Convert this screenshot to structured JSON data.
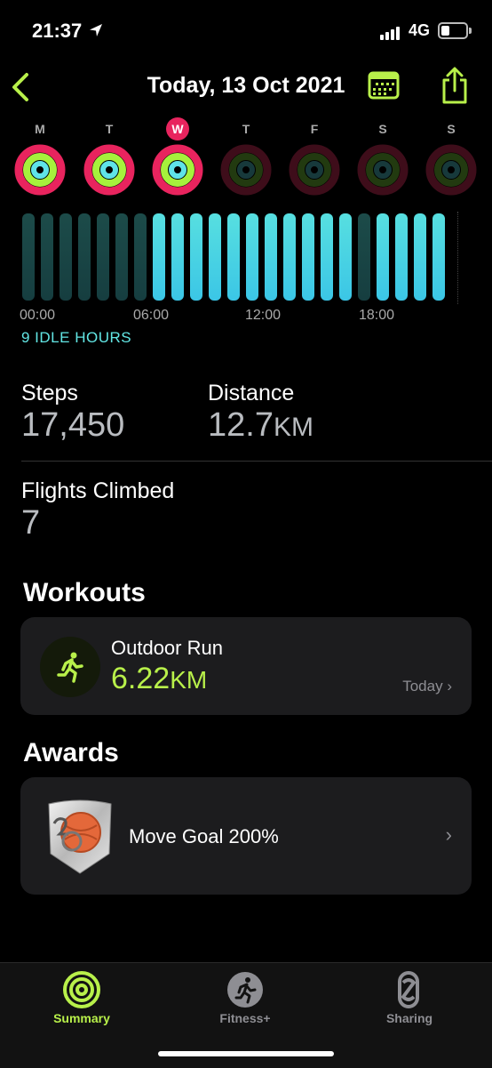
{
  "status": {
    "time": "21:37",
    "network": "4G"
  },
  "nav": {
    "title": "Today, 13 Oct 2021"
  },
  "week": {
    "days": [
      {
        "label": "M",
        "selected": false,
        "complete": true
      },
      {
        "label": "T",
        "selected": false,
        "complete": true
      },
      {
        "label": "W",
        "selected": true,
        "complete": true
      },
      {
        "label": "T",
        "selected": false,
        "complete": false
      },
      {
        "label": "F",
        "selected": false,
        "complete": false
      },
      {
        "label": "S",
        "selected": false,
        "complete": false
      },
      {
        "label": "S",
        "selected": false,
        "complete": false
      }
    ]
  },
  "hourly": {
    "stand_hours": [
      0,
      0,
      0,
      0,
      0,
      0,
      0,
      1,
      1,
      1,
      1,
      1,
      1,
      1,
      1,
      1,
      1,
      1,
      0,
      1,
      1,
      1,
      1,
      1
    ],
    "ticks": [
      "00:00",
      "06:00",
      "12:00",
      "18:00"
    ],
    "idle_label": "9 IDLE HOURS"
  },
  "stats": {
    "steps": {
      "label": "Steps",
      "value": "17,450"
    },
    "distance": {
      "label": "Distance",
      "value": "12.7",
      "unit": "KM"
    },
    "flights": {
      "label": "Flights Climbed",
      "value": "7"
    }
  },
  "workouts": {
    "heading": "Workouts",
    "item": {
      "title": "Outdoor Run",
      "value": "6.22",
      "unit": "KM",
      "date": "Today"
    }
  },
  "awards": {
    "heading": "Awards",
    "item": {
      "title": "Move Goal 200%"
    }
  },
  "tabs": [
    {
      "label": "Summary",
      "active": true
    },
    {
      "label": "Fitness+",
      "active": false
    },
    {
      "label": "Sharing",
      "active": false
    }
  ],
  "colors": {
    "accent": "#b8f04a",
    "move": "#e8245e",
    "exercise": "#a6f13c",
    "stand": "#5fe3e8"
  }
}
